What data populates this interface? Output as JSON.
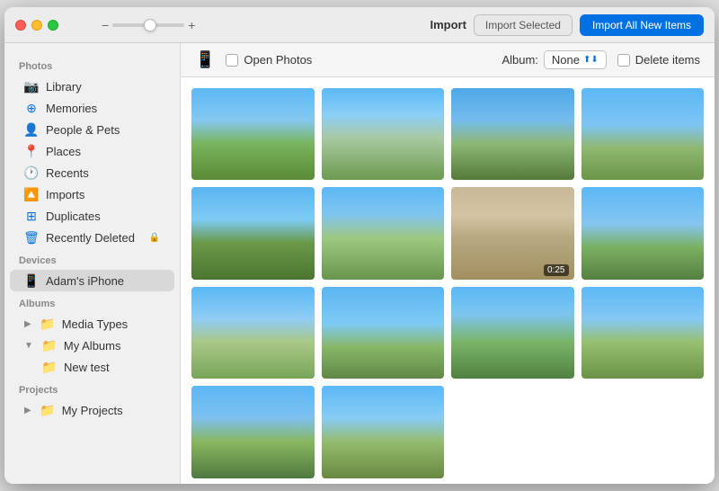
{
  "window": {
    "title": "Photos Import"
  },
  "titlebar": {
    "slider_minus": "−",
    "slider_plus": "+",
    "import_label": "Import",
    "btn_import_selected": "Import Selected",
    "btn_import_all": "Import All New Items"
  },
  "toolbar": {
    "open_photos_label": "Open Photos",
    "album_label": "Album:",
    "album_value": "None",
    "delete_items_label": "Delete items"
  },
  "sidebar": {
    "sections": [
      {
        "label": "Photos",
        "items": [
          {
            "id": "library",
            "label": "Library",
            "icon": "📷",
            "type": "photos"
          },
          {
            "id": "memories",
            "label": "Memories",
            "icon": "⊕",
            "type": "photos"
          },
          {
            "id": "people-pets",
            "label": "People & Pets",
            "icon": "👤",
            "type": "photos"
          },
          {
            "id": "places",
            "label": "Places",
            "icon": "📍",
            "type": "photos"
          },
          {
            "id": "recents",
            "label": "Recents",
            "icon": "🕐",
            "type": "photos"
          },
          {
            "id": "imports",
            "label": "Imports",
            "icon": "🔼",
            "type": "photos"
          },
          {
            "id": "duplicates",
            "label": "Duplicates",
            "icon": "⊞",
            "type": "photos"
          },
          {
            "id": "recently-deleted",
            "label": "Recently Deleted",
            "icon": "🗑",
            "type": "photos",
            "locked": true
          }
        ]
      },
      {
        "label": "Devices",
        "items": [
          {
            "id": "adams-iphone",
            "label": "Adam's iPhone",
            "icon": "📱",
            "type": "device",
            "active": true
          }
        ]
      },
      {
        "label": "Albums",
        "items": [
          {
            "id": "media-types",
            "label": "Media Types",
            "icon": "📁",
            "type": "album",
            "expand": "▶"
          },
          {
            "id": "my-albums",
            "label": "My Albums",
            "icon": "📁",
            "type": "album",
            "expand": "▼"
          },
          {
            "id": "new-test",
            "label": "New test",
            "icon": "📁",
            "type": "sub-album"
          }
        ]
      },
      {
        "label": "Projects",
        "items": [
          {
            "id": "my-projects",
            "label": "My Projects",
            "icon": "📁",
            "type": "project",
            "expand": "▶"
          }
        ]
      }
    ]
  },
  "photos": {
    "rows": [
      [
        {
          "id": "p1",
          "class": "ph1",
          "duration": null
        },
        {
          "id": "p2",
          "class": "ph2",
          "duration": null
        },
        {
          "id": "p3",
          "class": "ph3",
          "duration": null
        },
        {
          "id": "p4",
          "class": "ph4",
          "duration": null
        }
      ],
      [
        {
          "id": "p5",
          "class": "ph5",
          "duration": null
        },
        {
          "id": "p6",
          "class": "ph6",
          "duration": null
        },
        {
          "id": "p7",
          "class": "ph7",
          "duration": "0:25"
        },
        {
          "id": "p8",
          "class": "ph8",
          "duration": null
        }
      ],
      [
        {
          "id": "p9",
          "class": "ph9",
          "duration": null
        },
        {
          "id": "p10",
          "class": "ph10",
          "duration": null
        },
        {
          "id": "p11",
          "class": "ph11",
          "duration": null
        },
        {
          "id": "p12",
          "class": "ph12",
          "duration": null
        }
      ],
      [
        {
          "id": "p13",
          "class": "ph13",
          "duration": null
        },
        {
          "id": "p14",
          "class": "ph14",
          "duration": null
        },
        {
          "id": "p-empty1",
          "class": "",
          "duration": null,
          "empty": true
        },
        {
          "id": "p-empty2",
          "class": "",
          "duration": null,
          "empty": true
        }
      ]
    ]
  }
}
